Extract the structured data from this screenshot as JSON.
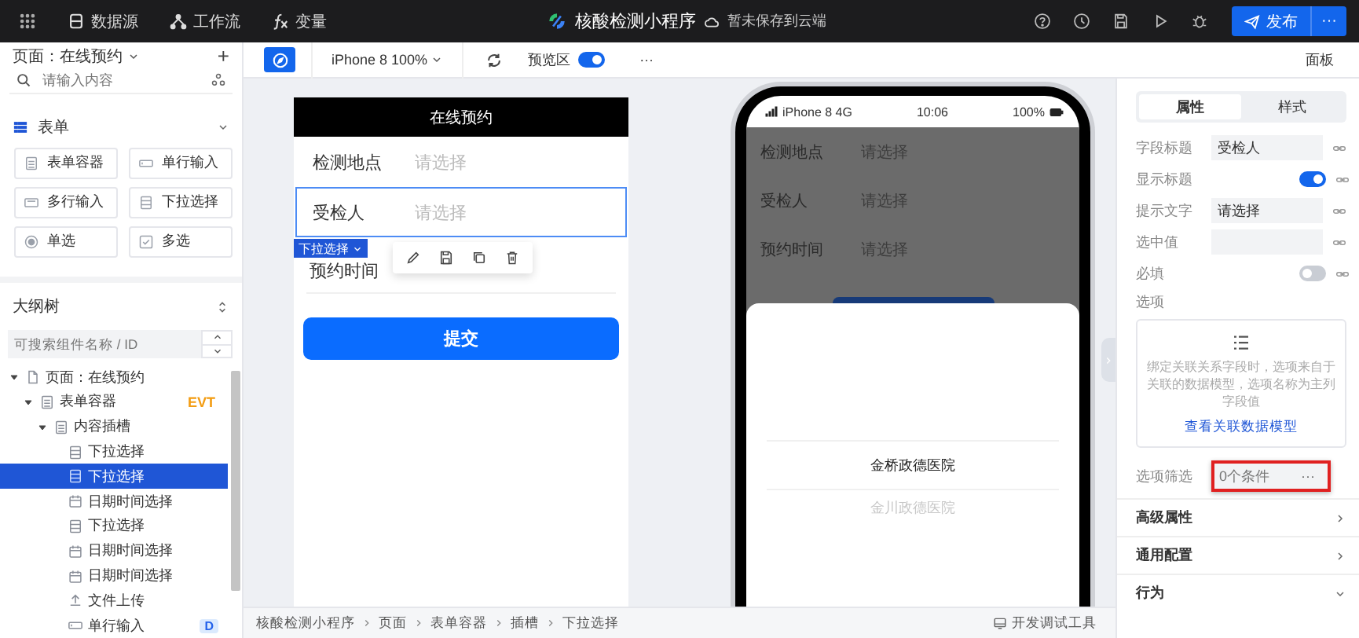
{
  "top_bar": {
    "nav_items": [
      {
        "label": "数据源"
      },
      {
        "label": "工作流"
      },
      {
        "label": "变量"
      }
    ],
    "app_title": "核酸检测小程序",
    "save_status": "暂未保存到云端",
    "publish_button": "发布",
    "publish_more": "···"
  },
  "toolbar": {
    "device": "iPhone 8 100%",
    "preview_label": "预览区",
    "preview_on": true,
    "more": "···",
    "panel_label": "面板"
  },
  "component_panel": {
    "page_selector": "页面：在线预约",
    "add": "+",
    "search": {
      "placeholder": "请输入内容"
    },
    "section": "表单",
    "components": [
      {
        "kind": "form",
        "label": "表单容器"
      },
      {
        "kind": "input",
        "label": "单行输入"
      },
      {
        "kind": "textarea",
        "label": "多行输入"
      },
      {
        "kind": "select",
        "label": "下拉选择"
      },
      {
        "kind": "radio",
        "label": "单选"
      },
      {
        "kind": "checkbox",
        "label": "多选"
      }
    ]
  },
  "outline": {
    "title": "大纲树",
    "search": {
      "placeholder": "可搜索组件名称 / ID"
    },
    "tree": [
      {
        "kind": "page",
        "label": "页面：在线预约",
        "selected": false,
        "expanded": true,
        "children": [
          {
            "kind": "form",
            "label": "表单容器",
            "badge": "EVT",
            "selected": false,
            "expanded": true,
            "children": [
              {
                "kind": "form",
                "label": "内容插槽",
                "selected": false,
                "expanded": true,
                "children": [
                  {
                    "kind": "select",
                    "label": "下拉选择",
                    "selected": false
                  },
                  {
                    "kind": "select",
                    "label": "下拉选择",
                    "selected": true
                  },
                  {
                    "kind": "datetime",
                    "label": "日期时间选择",
                    "selected": false
                  },
                  {
                    "kind": "select",
                    "label": "下拉选择",
                    "selected": false
                  },
                  {
                    "kind": "datetime",
                    "label": "日期时间选择",
                    "selected": false
                  },
                  {
                    "kind": "datetime",
                    "label": "日期时间选择",
                    "selected": false
                  },
                  {
                    "kind": "upload",
                    "label": "文件上传",
                    "selected": false
                  },
                  {
                    "kind": "input",
                    "label": "单行输入",
                    "tag": "D",
                    "selected": false
                  }
                ]
              }
            ]
          }
        ]
      }
    ]
  },
  "editor": {
    "header": "在线预约",
    "rows": [
      {
        "label": "检测地点",
        "placeholder": "请选择",
        "selected": false
      },
      {
        "label": "受检人",
        "placeholder": "请选择",
        "selected": true
      },
      {
        "label": "预约时间",
        "selected": false
      }
    ],
    "selection_badge": "下拉选择",
    "submit_button": "提交"
  },
  "preview": {
    "status": {
      "carrier": "iPhone 8  4G",
      "time": "10:06",
      "battery": "100%"
    },
    "rows": [
      {
        "label": "检测地点",
        "value": "请选择"
      },
      {
        "label": "受检人",
        "value": "请选择"
      },
      {
        "label": "预约时间",
        "value": "请选择"
      }
    ],
    "picker_options": [
      {
        "label": "金桥政德医院",
        "selected": true
      },
      {
        "label": "金川政德医院",
        "selected": false
      }
    ]
  },
  "breadcrumb": [
    "核酸检测小程序",
    "页面",
    "表单容器",
    "插槽",
    "下拉选择"
  ],
  "dev_tools": "开发调试工具",
  "properties": {
    "tabs": [
      {
        "label": "属性",
        "selected": true
      },
      {
        "label": "样式",
        "selected": false
      }
    ],
    "fields": [
      {
        "kind": "text",
        "label": "字段标题",
        "value": "受检人"
      },
      {
        "kind": "toggle",
        "label": "显示标题",
        "on": true
      },
      {
        "kind": "text",
        "label": "提示文字",
        "value": "请选择"
      },
      {
        "kind": "text",
        "label": "选中值"
      },
      {
        "kind": "toggle",
        "label": "必填",
        "on": false
      }
    ],
    "options": {
      "label": "选项",
      "hint": "绑定关联关系字段时，选项来自于关联的数据模型，选项名称为主列字段值",
      "link": "查看关联数据模型"
    },
    "option_filter": {
      "label": "选项筛选",
      "placeholder": "0个条件",
      "more": "···",
      "highlighted": true
    },
    "sections": [
      {
        "label": "高级属性",
        "expanded": false
      },
      {
        "label": "通用配置",
        "expanded": false
      },
      {
        "label": "行为",
        "expanded": true
      }
    ]
  }
}
